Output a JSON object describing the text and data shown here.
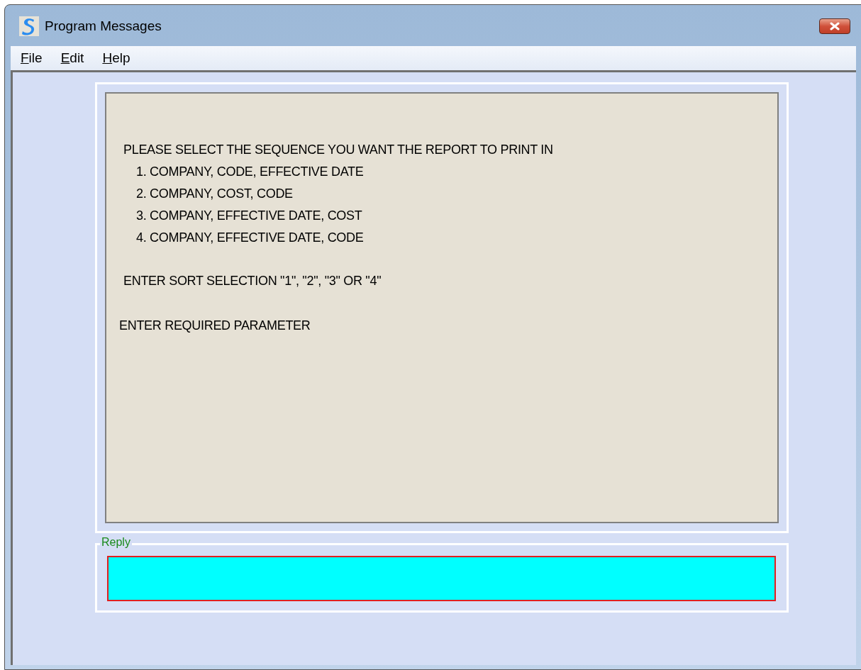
{
  "window": {
    "title": "Program Messages"
  },
  "menu": [
    "File",
    "Edit",
    "Help"
  ],
  "messages": [
    {
      "kind": "heading",
      "text": "PLEASE SELECT THE SEQUENCE YOU WANT THE REPORT TO PRINT IN"
    },
    {
      "kind": "option",
      "text": "1. COMPANY, CODE, EFFECTIVE DATE"
    },
    {
      "kind": "option",
      "text": "2. COMPANY, COST, CODE"
    },
    {
      "kind": "option",
      "text": "3. COMPANY, EFFECTIVE DATE, COST"
    },
    {
      "kind": "option",
      "text": "4. COMPANY, EFFECTIVE DATE, CODE"
    },
    {
      "kind": "prompt",
      "text": "ENTER SORT SELECTION \"1\", \"2\", \"3\" OR \"4\""
    },
    {
      "kind": "request",
      "text": "ENTER REQUIRED PARAMETER"
    }
  ],
  "reply": {
    "label": "Reply"
  }
}
